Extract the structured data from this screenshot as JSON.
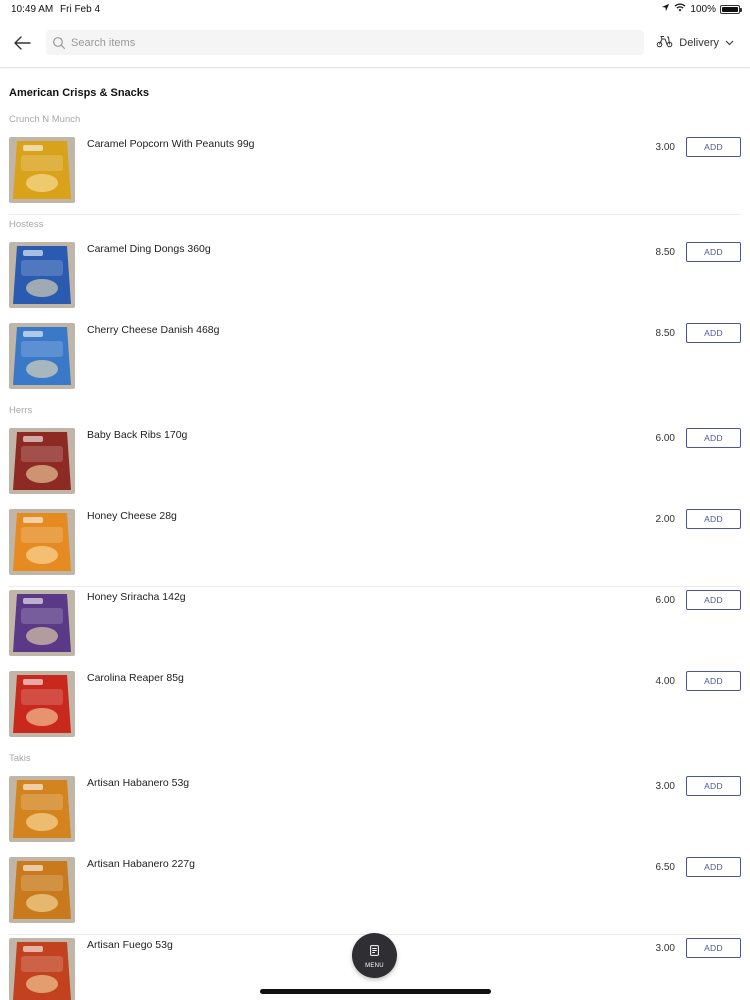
{
  "status": {
    "time": "10:49 AM",
    "date": "Fri Feb 4",
    "battery": "100%",
    "battery_level": 1.0
  },
  "header": {
    "search_placeholder": "Search items",
    "search_value": "",
    "delivery_label": "Delivery"
  },
  "category": {
    "title": "American Crisps & Snacks"
  },
  "brands": [
    {
      "name": "Crunch N Munch"
    },
    {
      "name": "Hostess"
    },
    {
      "name": "Herrs"
    },
    {
      "name": "Takis"
    }
  ],
  "items": [
    {
      "name": "Caramel Popcorn With Peanuts 99g",
      "price": "3.00",
      "add_label": "ADD",
      "color": "#d9a21b",
      "text_color": "#c0201e"
    },
    {
      "name": "Caramel Ding Dongs 360g",
      "price": "8.50",
      "add_label": "ADD",
      "color": "#2a5bb0",
      "text_color": "#e34a2a"
    },
    {
      "name": "Cherry Cheese Danish 468g",
      "price": "8.50",
      "add_label": "ADD",
      "color": "#3a78c8",
      "text_color": "#e84848"
    },
    {
      "name": "Baby Back Ribs 170g",
      "price": "6.00",
      "add_label": "ADD",
      "color": "#8e2a24",
      "text_color": "#f3e2d0"
    },
    {
      "name": "Honey Cheese 28g",
      "price": "2.00",
      "add_label": "ADD",
      "color": "#e68a22",
      "text_color": "#fff3c0"
    },
    {
      "name": "Honey Sriracha 142g",
      "price": "6.00",
      "add_label": "ADD",
      "color": "#5a3a86",
      "text_color": "#f3d060"
    },
    {
      "name": "Carolina Reaper 85g",
      "price": "4.00",
      "add_label": "ADD",
      "color": "#c9281c",
      "text_color": "#f6c440"
    },
    {
      "name": "Artisan Habanero 53g",
      "price": "3.00",
      "add_label": "ADD",
      "color": "#d4841e",
      "text_color": "#f8e7c0"
    },
    {
      "name": "Artisan Habanero 227g",
      "price": "6.50",
      "add_label": "ADD",
      "color": "#c87a1c",
      "text_color": "#f8e7c0"
    },
    {
      "name": "Artisan Fuego 53g",
      "price": "3.00",
      "add_label": "ADD",
      "color": "#c2411e",
      "text_color": "#f8e7c0"
    }
  ],
  "fab": {
    "label": "MENU"
  },
  "colors": {
    "accent": "#4a55a2",
    "fab": "#2f2f33",
    "brand_text": "#a8a8a8"
  }
}
